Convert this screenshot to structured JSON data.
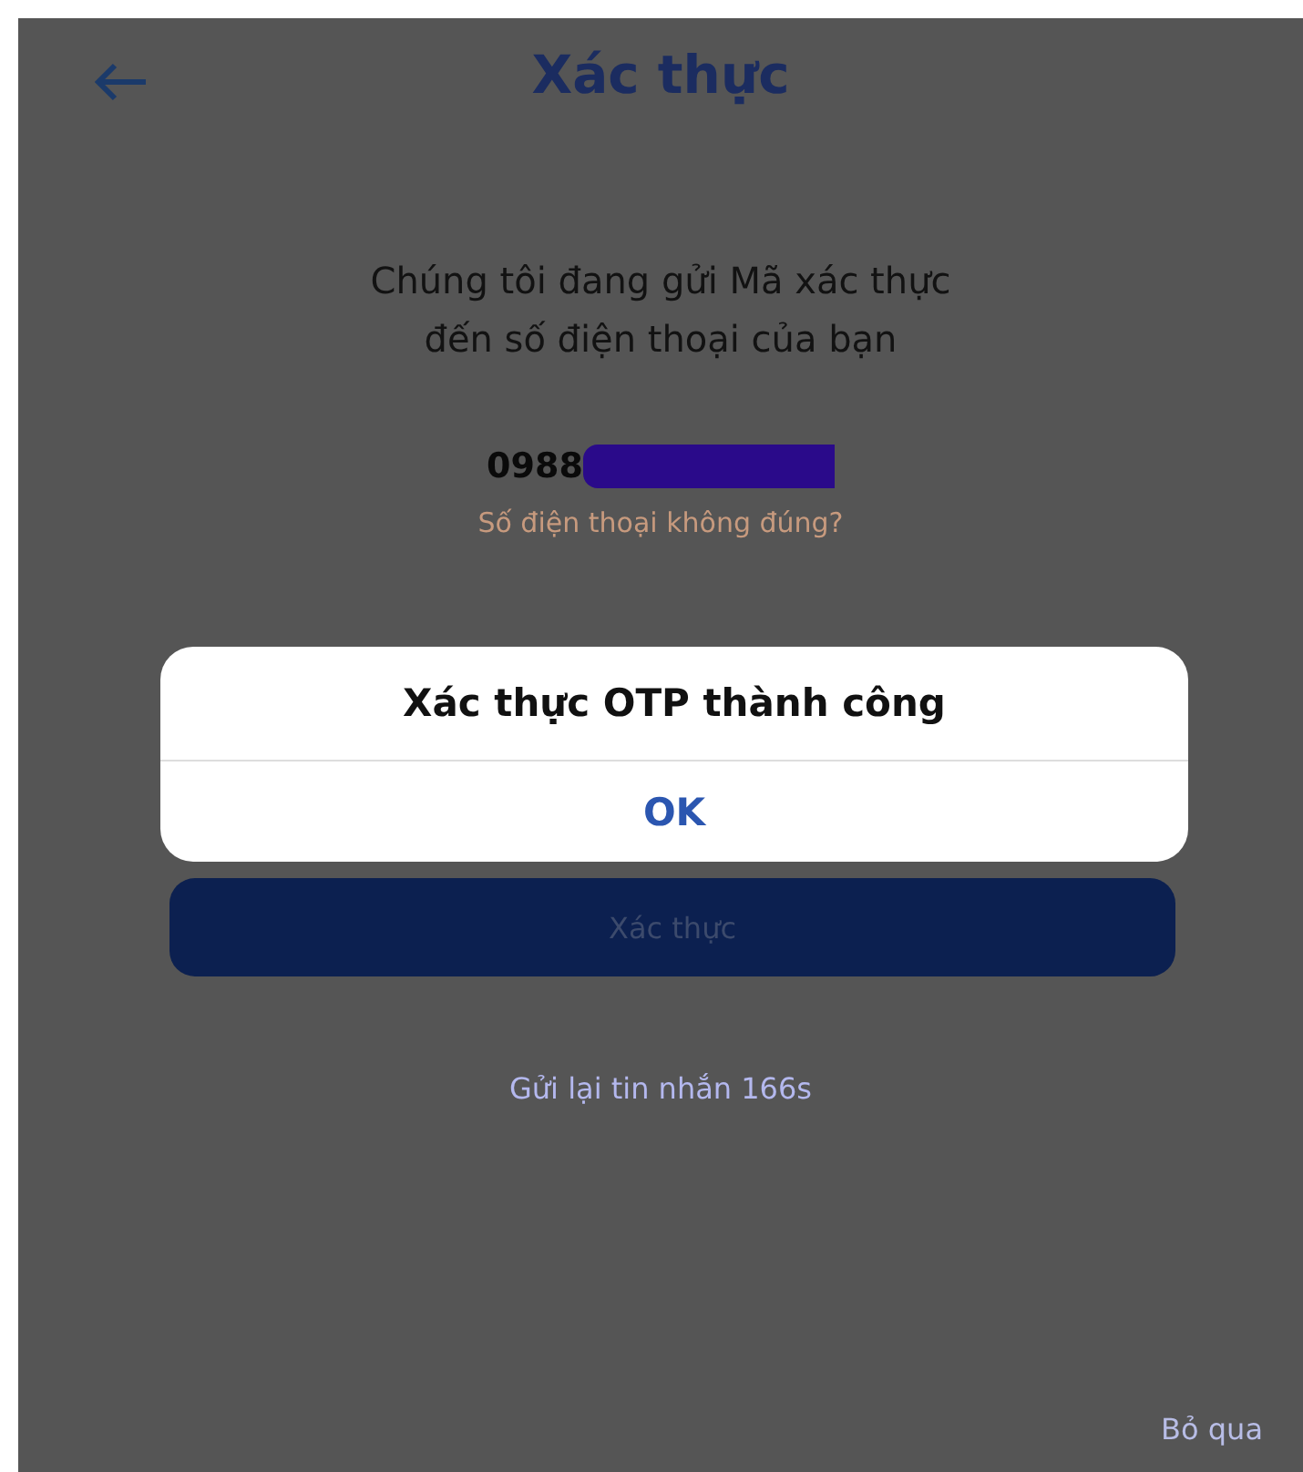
{
  "header": {
    "title": "Xác thực"
  },
  "message": "Chúng tôi đang gửi Mã xác thực đến số điện thoại của bạn",
  "phone": {
    "value": "0988",
    "redacted": true
  },
  "wrong_number_link": "Số điện thoại không đúng?",
  "verify_button": "Xác thực",
  "resend_text": "Gửi lại tin nhắn 166s",
  "skip_link": "Bỏ qua",
  "dialog": {
    "message": "Xác thực OTP thành công",
    "button": "OK"
  }
}
